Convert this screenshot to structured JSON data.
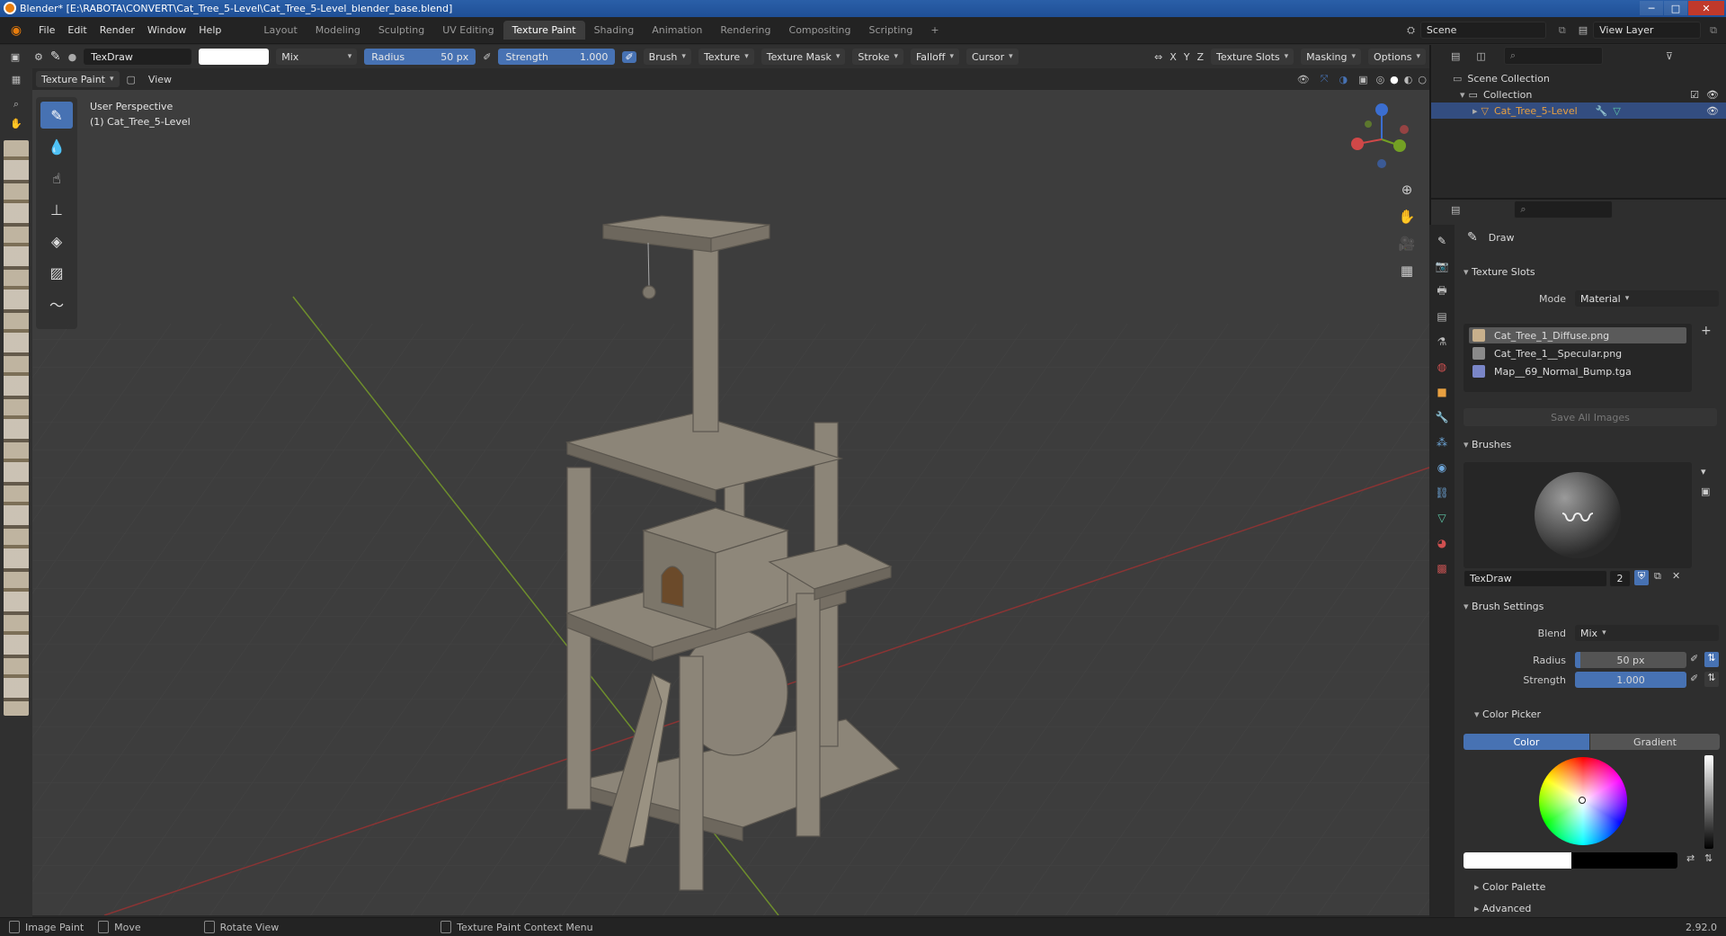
{
  "window": {
    "title": "Blender* [E:\\RABOTA\\CONVERT\\Cat_Tree_5-Level\\Cat_Tree_5-Level_blender_base.blend]"
  },
  "menu": [
    "File",
    "Edit",
    "Render",
    "Window",
    "Help"
  ],
  "workspaces": [
    "Layout",
    "Modeling",
    "Sculpting",
    "UV Editing",
    "Texture Paint",
    "Shading",
    "Animation",
    "Rendering",
    "Compositing",
    "Scripting"
  ],
  "active_workspace": "Texture Paint",
  "scene": {
    "name": "Scene",
    "view_layer": "View Layer"
  },
  "tool_header": {
    "brush_name": "TexDraw",
    "blend": "Mix",
    "radius_label": "Radius",
    "radius_value": "50 px",
    "strength_label": "Strength",
    "strength_value": "1.000",
    "menus": [
      "Brush",
      "Texture",
      "Texture Mask",
      "Stroke",
      "Falloff",
      "Cursor"
    ],
    "axes": [
      "X",
      "Y",
      "Z"
    ],
    "right_menus": [
      "Texture Slots",
      "Masking",
      "Options"
    ],
    "color_swatch": "#ffffff"
  },
  "viewport_header": {
    "mode": "Texture Paint",
    "view": "View"
  },
  "viewport": {
    "perspective": "User Perspective",
    "object": "(1) Cat_Tree_5-Level"
  },
  "outliner": {
    "root": "Scene Collection",
    "collection": "Collection",
    "object": "Cat_Tree_5-Level"
  },
  "properties": {
    "tool_name": "Draw",
    "texture_slots": {
      "title": "Texture Slots",
      "mode_label": "Mode",
      "mode_value": "Material",
      "slots": [
        "Cat_Tree_1_Diffuse.png",
        "Cat_Tree_1__Specular.png",
        "Map__69_Normal_Bump.tga"
      ],
      "save_all": "Save All Images"
    },
    "brushes": {
      "title": "Brushes",
      "brush_name": "TexDraw",
      "users": "2"
    },
    "brush_settings": {
      "title": "Brush Settings",
      "blend_label": "Blend",
      "blend_value": "Mix",
      "radius_label": "Radius",
      "radius_value": "50 px",
      "strength_label": "Strength",
      "strength_value": "1.000"
    },
    "color_picker": {
      "title": "Color Picker",
      "tab_color": "Color",
      "tab_gradient": "Gradient"
    },
    "color_palette": "Color Palette",
    "advanced": "Advanced"
  },
  "statusbar": {
    "items": [
      "Image Paint",
      "Move",
      "Rotate View",
      "Texture Paint Context Menu"
    ],
    "version": "2.92.0"
  },
  "colors": {
    "accent": "#4772b3",
    "selection": "#334d80"
  }
}
